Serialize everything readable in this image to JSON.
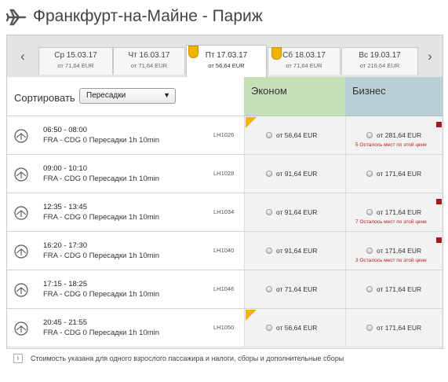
{
  "header": {
    "title": "Франкфурт-на-Майне - Париж",
    "icon": "airplane-icon"
  },
  "dates": {
    "prev_label": "‹",
    "next_label": "›",
    "tabs": [
      {
        "date": "Ср 15.03.17",
        "price": "от  71,64 EUR",
        "active": false,
        "badge": false
      },
      {
        "date": "Чт 16.03.17",
        "price": "от  71,64 EUR",
        "active": false,
        "badge": false
      },
      {
        "date": "Пт 17.03.17",
        "price": "от  56,64 EUR",
        "active": true,
        "badge": true
      },
      {
        "date": "Сб 18.03.17",
        "price": "от  71,64 EUR",
        "active": false,
        "badge": true
      },
      {
        "date": "Вс 19.03.17",
        "price": "от  216,64 EUR",
        "active": false,
        "badge": false
      }
    ]
  },
  "sort": {
    "label": "Сортировать",
    "selected": "Пересадки"
  },
  "columns": {
    "economy": "Эконом",
    "business": "Бизнес",
    "economy_color": "#c7dfb9",
    "business_color": "#b9d0d6"
  },
  "flights": [
    {
      "time": "06:50 - 08:00",
      "route": "FRA - CDG   0 Пересадки   1h 10min",
      "flight_no": "LH1026",
      "economy_price": "от 56,64 EUR",
      "business_price": "от 281,64 EUR",
      "seats_left": "5 Осталось мест по этой цене",
      "best": true
    },
    {
      "time": "09:00 - 10:10",
      "route": "FRA - CDG   0 Пересадки   1h 10min",
      "flight_no": "LH1028",
      "economy_price": "от 91,64 EUR",
      "business_price": "от 171,64 EUR",
      "seats_left": "",
      "best": false
    },
    {
      "time": "12:35 - 13:45",
      "route": "FRA - CDG   0 Пересадки   1h 10min",
      "flight_no": "LH1034",
      "economy_price": "от 91,64 EUR",
      "business_price": "от 171,64 EUR",
      "seats_left": "7 Осталось мест по этой цене",
      "best": false
    },
    {
      "time": "16:20 - 17:30",
      "route": "FRA - CDG   0 Пересадки   1h 10min",
      "flight_no": "LH1040",
      "economy_price": "от 91,64 EUR",
      "business_price": "от 171,64 EUR",
      "seats_left": "3 Осталось мест по этой цене",
      "best": false
    },
    {
      "time": "17:15 - 18:25",
      "route": "FRA - CDG   0 Пересадки   1h 10min",
      "flight_no": "LH1046",
      "economy_price": "от 71,64 EUR",
      "business_price": "от 171,64 EUR",
      "seats_left": "",
      "best": false
    },
    {
      "time": "20:45 - 21:55",
      "route": "FRA - CDG   0 Пересадки   1h 10min",
      "flight_no": "LH1050",
      "economy_price": "от 56,64 EUR",
      "business_price": "от 171,64 EUR",
      "seats_left": "",
      "best": true
    }
  ],
  "footer": {
    "icon_label": "i",
    "text": "Стоимость указана для одного взрослого пассажира и налоги, сборы и дополнительные сборы"
  }
}
